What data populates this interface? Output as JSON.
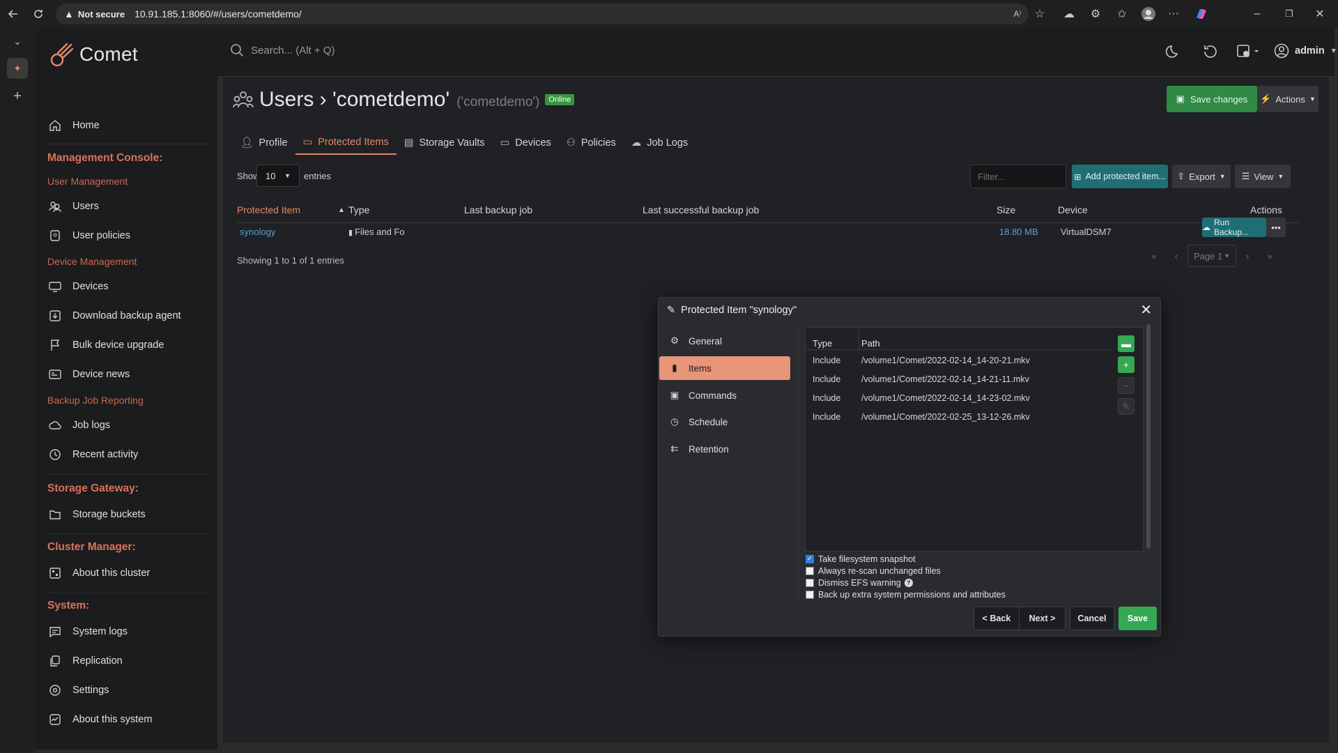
{
  "browser": {
    "security_label": "Not secure",
    "url": "10.91.185.1:8060/#/users/cometdemo/"
  },
  "app": {
    "brand": "Comet",
    "search_placeholder": "Search... (Alt + Q)",
    "user_label": "admin"
  },
  "sidebar": {
    "home": "Home",
    "management_console": "Management Console:",
    "user_management": "User Management",
    "users": "Users",
    "user_policies": "User policies",
    "device_management": "Device Management",
    "devices": "Devices",
    "download_agent": "Download backup agent",
    "bulk_upgrade": "Bulk device upgrade",
    "device_news": "Device news",
    "backup_reporting": "Backup Job Reporting",
    "job_logs": "Job logs",
    "recent_activity": "Recent activity",
    "storage_gateway": "Storage Gateway:",
    "storage_buckets": "Storage buckets",
    "cluster_manager": "Cluster Manager:",
    "about_cluster": "About this cluster",
    "system": "System:",
    "system_logs": "System logs",
    "replication": "Replication",
    "settings": "Settings",
    "about_system": "About this system"
  },
  "page": {
    "title": "Users › 'cometdemo'",
    "subtitle": "('cometdemo')",
    "badge": "Online",
    "save_changes": "Save changes",
    "actions": "Actions"
  },
  "tabs": [
    "Profile",
    "Protected Items",
    "Storage Vaults",
    "Devices",
    "Policies",
    "Job Logs"
  ],
  "table": {
    "show_label": "Show",
    "page_size": "10",
    "entries_label": "entries",
    "filter_placeholder": "Filter...",
    "add_button": "Add protected item...",
    "export_button": "Export",
    "view_button": "View",
    "headers": {
      "protected_item": "Protected Item",
      "type": "Type",
      "last_backup": "Last backup job",
      "last_success": "Last successful backup job",
      "size": "Size",
      "device": "Device",
      "actions": "Actions"
    },
    "row": {
      "name": "synology",
      "type": "Files and Fo",
      "size": "18.80 MB",
      "device": "VirtualDSM7",
      "run_backup": "Run Backup..."
    },
    "showing_info": "Showing 1 to 1 of 1 entries",
    "page_label": "Page 1"
  },
  "modal": {
    "title": "Protected Item \"synology\"",
    "nav": [
      "General",
      "Items",
      "Commands",
      "Schedule",
      "Retention"
    ],
    "active_nav": "Items",
    "col_type": "Type",
    "col_path": "Path",
    "items": [
      {
        "type": "Include",
        "path": "/volume1/Comet/2022-02-14_14-20-21.mkv"
      },
      {
        "type": "Include",
        "path": "/volume1/Comet/2022-02-14_14-21-11.mkv"
      },
      {
        "type": "Include",
        "path": "/volume1/Comet/2022-02-14_14-23-02.mkv"
      },
      {
        "type": "Include",
        "path": "/volume1/Comet/2022-02-25_13-12-26.mkv"
      }
    ],
    "options": [
      {
        "label": "Take filesystem snapshot",
        "checked": true
      },
      {
        "label": "Always re-scan unchanged files",
        "checked": false
      },
      {
        "label": "Dismiss EFS warning",
        "checked": false
      },
      {
        "label": "Back up extra system permissions and attributes",
        "checked": false
      }
    ],
    "back": "< Back",
    "next": "Next >",
    "cancel": "Cancel",
    "save": "Save"
  },
  "colors": {
    "accent": "#e58668",
    "success": "#34a853",
    "teal": "#1f6e74",
    "sidebar_bg": "#1b1c1e"
  }
}
